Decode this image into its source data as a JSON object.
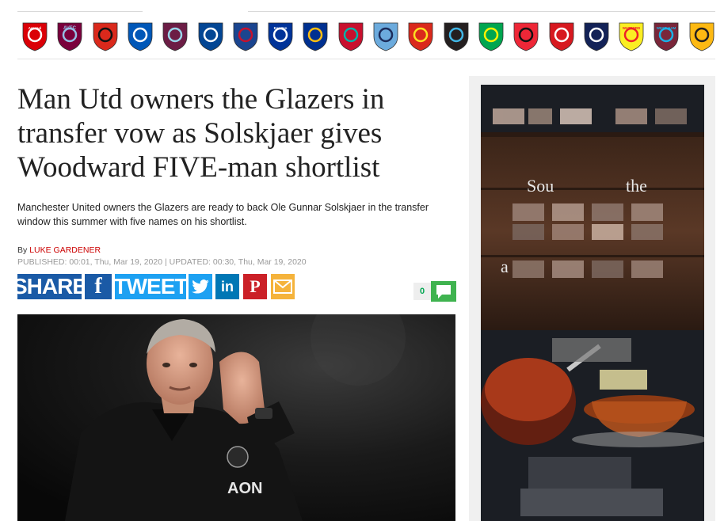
{
  "clubs": [
    {
      "name": "Arsenal",
      "icon": "arsenal-crest-icon",
      "color": "#db0007",
      "accent": "#ffffff",
      "label": "Arsenal"
    },
    {
      "name": "Aston Villa",
      "icon": "aston-villa-crest-icon",
      "color": "#7a003c",
      "accent": "#95bfe5",
      "label": "AVFC"
    },
    {
      "name": "Bournemouth",
      "icon": "bournemouth-crest-icon",
      "color": "#da291c",
      "accent": "#111111",
      "label": ""
    },
    {
      "name": "Brighton",
      "icon": "brighton-crest-icon",
      "color": "#0057b8",
      "accent": "#ffffff",
      "label": ""
    },
    {
      "name": "Burnley",
      "icon": "burnley-crest-icon",
      "color": "#6c1d45",
      "accent": "#99d6ea",
      "label": ""
    },
    {
      "name": "Chelsea",
      "icon": "chelsea-crest-icon",
      "color": "#034694",
      "accent": "#ffffff",
      "label": ""
    },
    {
      "name": "Crystal Palace",
      "icon": "crystal-palace-crest-icon",
      "color": "#1b458f",
      "accent": "#c4122e",
      "label": ""
    },
    {
      "name": "Everton",
      "icon": "everton-crest-icon",
      "color": "#003399",
      "accent": "#ffffff",
      "label": "Everton"
    },
    {
      "name": "Leicester City",
      "icon": "leicester-crest-icon",
      "color": "#003090",
      "accent": "#fdbe11",
      "label": ""
    },
    {
      "name": "Liverpool",
      "icon": "liverpool-crest-icon",
      "color": "#c8102e",
      "accent": "#00b2a9",
      "label": ""
    },
    {
      "name": "Manchester City",
      "icon": "man-city-crest-icon",
      "color": "#6cabdd",
      "accent": "#1c2c5b",
      "label": ""
    },
    {
      "name": "Manchester United",
      "icon": "man-utd-crest-icon",
      "color": "#da291c",
      "accent": "#fbe122",
      "label": ""
    },
    {
      "name": "Newcastle United",
      "icon": "newcastle-crest-icon",
      "color": "#241f20",
      "accent": "#41b6e6",
      "label": ""
    },
    {
      "name": "Norwich City",
      "icon": "norwich-crest-icon",
      "color": "#00a650",
      "accent": "#fff200",
      "label": ""
    },
    {
      "name": "Sheffield United",
      "icon": "sheffield-utd-crest-icon",
      "color": "#ee2737",
      "accent": "#111111",
      "label": ""
    },
    {
      "name": "Southampton",
      "icon": "southampton-crest-icon",
      "color": "#d71920",
      "accent": "#ffffff",
      "label": ""
    },
    {
      "name": "Tottenham",
      "icon": "tottenham-crest-icon",
      "color": "#132257",
      "accent": "#ffffff",
      "label": ""
    },
    {
      "name": "Watford",
      "icon": "watford-crest-icon",
      "color": "#fbee23",
      "accent": "#ed2127",
      "label": "WATFORD"
    },
    {
      "name": "West Ham",
      "icon": "west-ham-crest-icon",
      "color": "#7a263a",
      "accent": "#1bb1e7",
      "label": "WEST HAM"
    },
    {
      "name": "Wolves",
      "icon": "wolves-crest-icon",
      "color": "#fdb913",
      "accent": "#231f20",
      "label": ""
    }
  ],
  "article": {
    "headline": "Man Utd owners the Glazers in transfer vow as Solskjaer gives Woodward FIVE-man shortlist",
    "summary": "Manchester United owners the Glazers are ready to back Ole Gunnar Solskjaer in the transfer window this summer with five names on his shortlist.",
    "by_prefix": "By",
    "author": "LUKE GARDENER",
    "dates": "PUBLISHED: 00:01, Thu, Mar 19, 2020 | UPDATED: 00:30, Thu, Mar 19, 2020"
  },
  "share": {
    "share_label": "SHARE",
    "facebook_icon": "f",
    "tweet_label": "TWEET",
    "linkedin_icon": "in",
    "pinterest_icon": "P",
    "comment_count": "0",
    "colors": {
      "share": "#1a5aa6",
      "facebook": "#3b5998",
      "tweet": "#1da1f2",
      "linkedin": "#0077b5",
      "pinterest": "#cb2027",
      "email": "#f5b33b"
    }
  },
  "hero": {
    "sponsor_text": "AON"
  },
  "ad": {
    "line1": "Sou",
    "line1b": "the",
    "line2": "a"
  }
}
